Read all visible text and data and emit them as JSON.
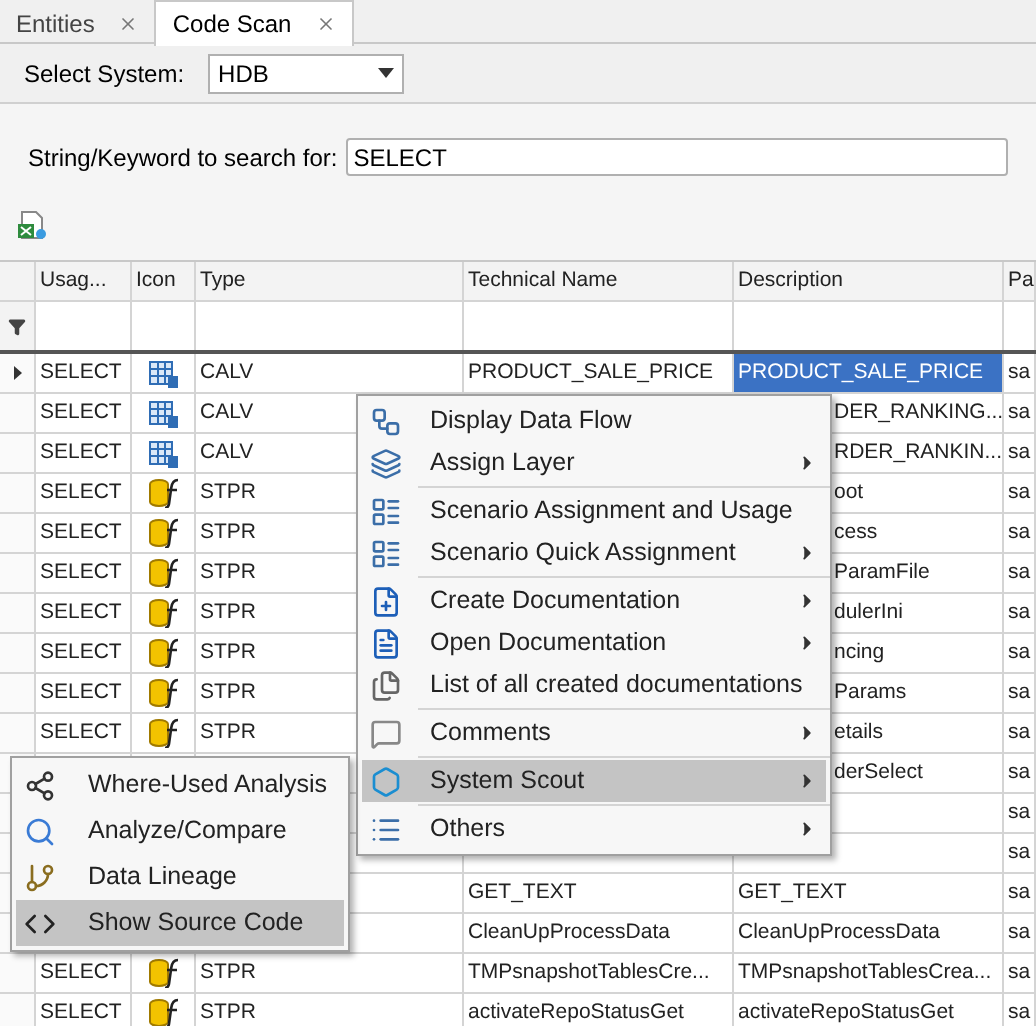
{
  "tabs": [
    {
      "label": "Entities",
      "selected": false
    },
    {
      "label": "Code Scan",
      "selected": true
    }
  ],
  "system": {
    "label": "Select System:",
    "value": "HDB"
  },
  "search": {
    "label": "String/Keyword to search for:",
    "value": "SELECT"
  },
  "table": {
    "columns": [
      "Usag...",
      "Icon",
      "Type",
      "Technical Name",
      "Description",
      "Pa"
    ],
    "rows": [
      {
        "usage": "SELECT",
        "kind": "calc",
        "type": "CALV",
        "technical_name": "PRODUCT_SALE_PRICE",
        "description": "PRODUCT_SALE_PRICE",
        "column_6": "sa",
        "selected": true,
        "covered": false
      },
      {
        "usage": "SELECT",
        "kind": "calc",
        "type": "CALV",
        "description": "DER_RANKING...",
        "column_6": "sa",
        "selected": false,
        "covered": true
      },
      {
        "usage": "SELECT",
        "kind": "calc",
        "type": "CALV",
        "description": "RDER_RANKIN...",
        "column_6": "sa",
        "selected": false,
        "covered": true
      },
      {
        "usage": "SELECT",
        "kind": "proc",
        "type": "STPR",
        "description": "oot",
        "column_6": "sa",
        "selected": false,
        "covered": true
      },
      {
        "usage": "SELECT",
        "kind": "proc",
        "type": "STPR",
        "description": "cess",
        "column_6": "sa",
        "selected": false,
        "covered": true
      },
      {
        "usage": "SELECT",
        "kind": "proc",
        "type": "STPR",
        "description": "ParamFile",
        "column_6": "sa",
        "selected": false,
        "covered": true
      },
      {
        "usage": "SELECT",
        "kind": "proc",
        "type": "STPR",
        "description": "dulerIni",
        "column_6": "sa",
        "selected": false,
        "covered": true
      },
      {
        "usage": "SELECT",
        "kind": "proc",
        "type": "STPR",
        "description": "ncing",
        "column_6": "sa",
        "selected": false,
        "covered": true
      },
      {
        "usage": "SELECT",
        "kind": "proc",
        "type": "STPR",
        "description": "Params",
        "column_6": "sa",
        "selected": false,
        "covered": true
      },
      {
        "usage": "SELECT",
        "kind": "proc",
        "type": "STPR",
        "description": "etails",
        "column_6": "sa",
        "selected": false,
        "covered": true
      },
      {
        "description": "derSelect",
        "column_6": "sa",
        "covered": true
      },
      {
        "column_6": "sa"
      },
      {
        "column_6": "sa"
      },
      {
        "technical_name": "GET_TEXT",
        "description": "GET_TEXT",
        "column_6": "sa",
        "covered": false
      },
      {
        "technical_name": "CleanUpProcessData",
        "description": "CleanUpProcessData",
        "column_6": "sa",
        "covered": false
      },
      {
        "usage": "SELECT",
        "kind": "proc",
        "type": "STPR",
        "technical_name": "TMPsnapshotTablesCre...",
        "description": "TMPsnapshotTablesCrea...",
        "column_6": "sa",
        "selected": false,
        "covered": false
      },
      {
        "usage": "SELECT",
        "kind": "proc",
        "type": "STPR",
        "technical_name": "activateRepoStatusGet",
        "description": "activateRepoStatusGet",
        "column_6": "sa",
        "selected": false,
        "covered": false
      }
    ]
  },
  "context_menu": {
    "items": [
      {
        "label": "Display Data Flow",
        "kind": "flow",
        "submenu": false,
        "selected": false
      },
      {
        "label": "Assign Layer",
        "kind": "layers",
        "submenu": true,
        "selected": false
      },
      {
        "kind": "separator"
      },
      {
        "label": "Scenario Assignment and Usage",
        "kind": "scenario",
        "submenu": false,
        "selected": false
      },
      {
        "label": "Scenario Quick Assignment",
        "kind": "scenario",
        "submenu": true,
        "selected": false
      },
      {
        "kind": "separator"
      },
      {
        "label": "Create Documentation",
        "kind": "doc_create",
        "submenu": true,
        "selected": false
      },
      {
        "label": "Open Documentation",
        "kind": "doc",
        "submenu": true,
        "selected": false
      },
      {
        "label": "List of all created documentations",
        "kind": "docs",
        "submenu": false,
        "selected": false
      },
      {
        "kind": "separator"
      },
      {
        "label": "Comments",
        "kind": "comment",
        "submenu": true,
        "selected": false
      },
      {
        "kind": "separator"
      },
      {
        "label": "System Scout",
        "kind": "scout",
        "submenu": true,
        "selected": true
      },
      {
        "kind": "separator"
      },
      {
        "label": "Others",
        "kind": "list",
        "submenu": true,
        "selected": false
      }
    ]
  },
  "submenu": {
    "items": [
      {
        "label": "Where-Used Analysis",
        "kind": "where",
        "selected": false
      },
      {
        "label": "Analyze/Compare",
        "kind": "magnifier",
        "selected": false
      },
      {
        "label": "Data Lineage",
        "kind": "lineage",
        "selected": false
      },
      {
        "label": "Show Source Code",
        "kind": "code",
        "selected": true
      }
    ]
  }
}
